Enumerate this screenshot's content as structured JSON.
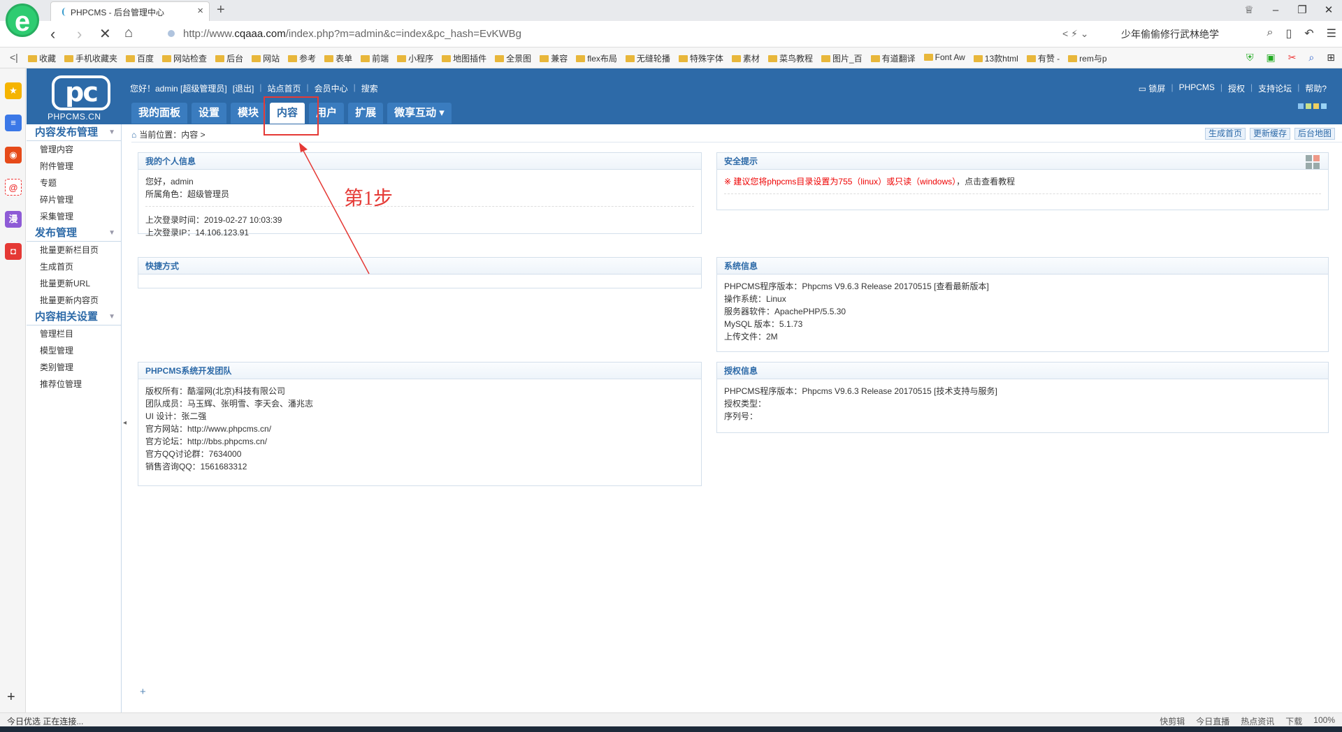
{
  "browser": {
    "tab_title": "PHPCMS - 后台管理中心",
    "url_prefix": "http://www.",
    "url_domain": "cqaaa.com",
    "url_path": "/index.php?m=admin&c=index&pc_hash=EvKWBg",
    "search_hint": "少年偷偷修行武林绝学",
    "bookmarks": [
      "收藏",
      "手机收藏夹",
      "百度",
      "网站检查",
      "后台",
      "网站",
      "参考",
      "表单",
      "前端",
      "小程序",
      "地图插件",
      "全景图",
      "兼容",
      "flex布局",
      "无缝轮播",
      "特殊字体",
      "素材",
      "菜鸟教程",
      "图片_百",
      "有道翻译",
      "Font Aw",
      "13款html",
      "有赞 -",
      "rem与p"
    ]
  },
  "cms": {
    "logo_name": "PHPCMS.CN",
    "greeting": "您好！admin [超级管理员]",
    "logout": "[退出]",
    "site_home": "站点首页",
    "member_center": "会员中心",
    "search": "搜索",
    "right_links": [
      "锁屏",
      "PHPCMS",
      "授权",
      "支持论坛",
      "帮助?"
    ],
    "nav_tabs": [
      "我的面板",
      "设置",
      "模块",
      "内容",
      "用户",
      "扩展",
      "微享互动"
    ],
    "breadcrumb": "当前位置：内容 >",
    "quick_buttons": [
      "生成首页",
      "更新缓存",
      "后台地图"
    ]
  },
  "left_menu": {
    "groups": [
      {
        "title": "内容发布管理",
        "items": [
          "管理内容",
          "附件管理",
          "专题",
          "碎片管理",
          "采集管理"
        ]
      },
      {
        "title": "发布管理",
        "items": [
          "批量更新栏目页",
          "生成首页",
          "批量更新URL",
          "批量更新内容页"
        ]
      },
      {
        "title": "内容相关设置",
        "items": [
          "管理栏目",
          "模型管理",
          "类别管理",
          "推荐位管理"
        ]
      }
    ]
  },
  "panels": {
    "personal": {
      "title": "我的个人信息",
      "hello": "您好，admin",
      "role": "所属角色：超级管理员",
      "last_time": "上次登录时间：2019-02-27 10:03:39",
      "last_ip": "上次登录IP：14.106.123.91"
    },
    "security": {
      "title": "安全提示",
      "warning": "※ 建议您将phpcms目录设置为755（linux）或只读（windows）",
      "tail": "，点击查看教程"
    },
    "shortcuts": {
      "title": "快捷方式"
    },
    "sysinfo": {
      "title": "系统信息",
      "rows": [
        "PHPCMS程序版本：Phpcms V9.6.3 Release 20170515 [查看最新版本]",
        "操作系统：Linux",
        "服务器软件：ApachePHP/5.5.30",
        "MySQL 版本：5.1.73",
        "上传文件：2M"
      ]
    },
    "team": {
      "title": "PHPCMS系统开发团队",
      "rows": [
        "版权所有：酷溜网(北京)科技有限公司",
        "团队成员：马玉辉、张明雪、李天会、潘兆志",
        "UI 设计：张二强",
        "官方网站：http://www.phpcms.cn/",
        "官方论坛：http://bbs.phpcms.cn/",
        "官方QQ讨论群：7634000",
        "销售咨询QQ：1561683312"
      ]
    },
    "license": {
      "title": "授权信息",
      "rows": [
        "PHPCMS程序版本：Phpcms V9.6.3 Release 20170515 [技术支持与服务]",
        "授权类型：",
        "序列号："
      ]
    }
  },
  "annotation": {
    "label": "第1步",
    "color": "#e53935"
  },
  "status": {
    "left": "今日优选   正在连接...",
    "right": [
      "快剪辑",
      "今日直播",
      "热点资讯",
      "下载",
      "100%"
    ]
  }
}
